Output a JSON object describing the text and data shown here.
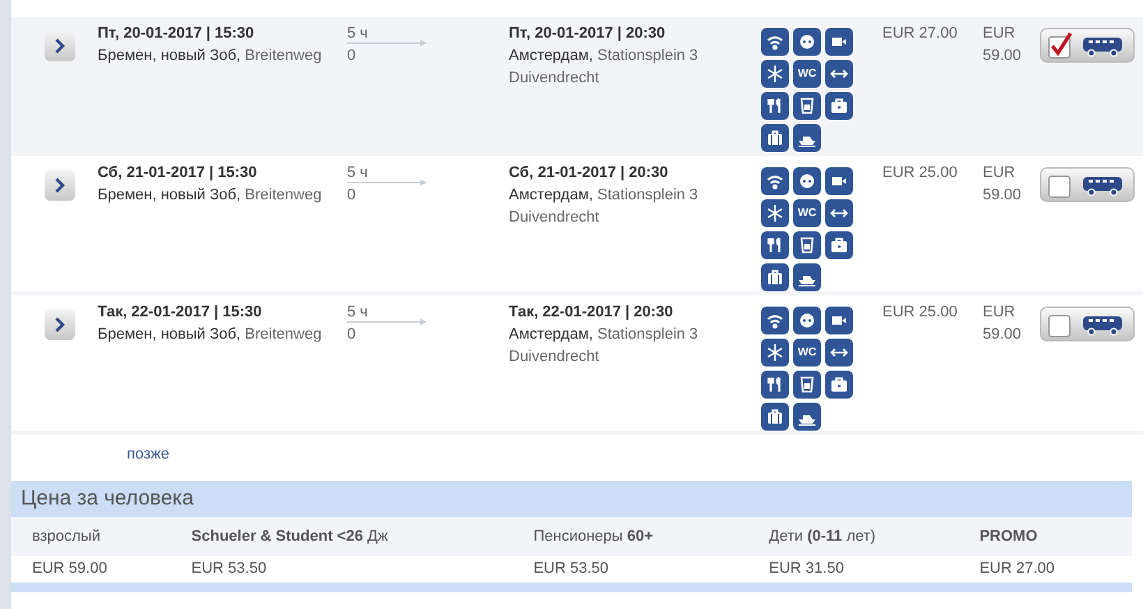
{
  "trips": [
    {
      "selected": true,
      "depart_date": "Пт, 20-01-2017 | 15:30",
      "depart_city": "Бремен, новый Зоб,",
      "depart_stop": "Breitenweg",
      "duration": "5 ч",
      "transfers": "0",
      "arrive_date": "Пт, 20-01-2017 | 20:30",
      "arrive_city": "Амстердам,",
      "arrive_stop": "Stationsplein 3",
      "arrive_area": "Duivendrecht",
      "wc_label": "WC",
      "price": "EUR 27.00",
      "full_price": "EUR 59.00"
    },
    {
      "selected": false,
      "depart_date": "Сб, 21-01-2017 | 15:30",
      "depart_city": "Бремен, новый Зоб,",
      "depart_stop": "Breitenweg",
      "duration": "5 ч",
      "transfers": "0",
      "arrive_date": "Сб, 21-01-2017 | 20:30",
      "arrive_city": "Амстердам,",
      "arrive_stop": "Stationsplein 3",
      "arrive_area": "Duivendrecht",
      "wc_label": "WC",
      "price": "EUR 25.00",
      "full_price": "EUR 59.00"
    },
    {
      "selected": false,
      "depart_date": "Так, 22-01-2017 | 15:30",
      "depart_city": "Бремен, новый Зоб,",
      "depart_stop": "Breitenweg",
      "duration": "5 ч",
      "transfers": "0",
      "arrive_date": "Так, 22-01-2017 | 20:30",
      "arrive_city": "Амстердам,",
      "arrive_stop": "Stationsplein 3",
      "arrive_area": "Duivendrecht",
      "wc_label": "WC",
      "price": "EUR 25.00",
      "full_price": "EUR 59.00"
    }
  ],
  "later_link": "позже",
  "price_table": {
    "title": "Цена за человека",
    "columns": [
      "взрослый",
      "**Schueler & Student <26** Дж",
      "Пенсионеры **60+**",
      "Дети **(0-11** лет)",
      "**PROMO**"
    ],
    "values": [
      "EUR 59.00",
      "EUR 53.50",
      "EUR 53.50",
      "EUR 31.50",
      "EUR 27.00"
    ]
  }
}
